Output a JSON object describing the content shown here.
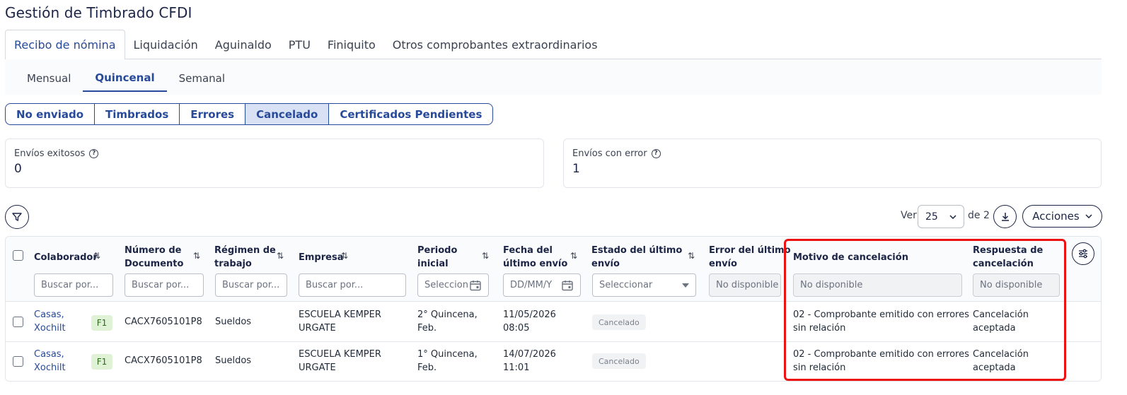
{
  "page": {
    "title": "Gestión de Timbrado CFDI"
  },
  "main_tabs": [
    {
      "label": "Recibo de nómina",
      "active": true
    },
    {
      "label": "Liquidación"
    },
    {
      "label": "Aguinaldo"
    },
    {
      "label": "PTU"
    },
    {
      "label": "Finiquito"
    },
    {
      "label": "Otros comprobantes extraordinarios"
    }
  ],
  "sub_tabs": [
    {
      "label": "Mensual"
    },
    {
      "label": "Quincenal",
      "active": true
    },
    {
      "label": "Semanal"
    }
  ],
  "status_filters": [
    {
      "label": "No enviado"
    },
    {
      "label": "Timbrados"
    },
    {
      "label": "Errores"
    },
    {
      "label": "Cancelado",
      "active": true
    },
    {
      "label": "Certificados Pendientes"
    }
  ],
  "stats": {
    "success": {
      "label": "Envíos exitosos",
      "value": "0"
    },
    "error": {
      "label": "Envíos con error",
      "value": "1"
    }
  },
  "toolbar": {
    "ver_label": "Ver",
    "page_size": "25",
    "de_label": "de 2",
    "actions_label": "Acciones"
  },
  "table": {
    "headers": {
      "colaborador": "Colaborador",
      "numero_doc": [
        "Número de",
        "Documento"
      ],
      "regimen": [
        "Régimen de",
        "trabajo"
      ],
      "empresa": "Empresa",
      "periodo": [
        "Periodo",
        "inicial"
      ],
      "fecha": [
        "Fecha del",
        "último envío"
      ],
      "estado": [
        "Estado del último",
        "envío"
      ],
      "error": [
        "Error del último",
        "envío"
      ],
      "motivo": "Motivo de cancelación",
      "respuesta": [
        "Respuesta de",
        "cancelación"
      ]
    },
    "filters": {
      "colaborador": "Buscar por...",
      "numero_doc": "Buscar por...",
      "regimen": "Buscar por...",
      "empresa": "Buscar por...",
      "periodo": "Seleccion",
      "fecha": "DD/MM/Y",
      "estado": "Seleccionar",
      "error": "No disponible",
      "motivo": "No disponible",
      "respuesta": "No disponible"
    },
    "rows": [
      {
        "colaborador": [
          "Casas,",
          "Xochilt"
        ],
        "badge": "F1",
        "numero_doc": "CACX7605101P8",
        "regimen": "Sueldos",
        "empresa": [
          "ESCUELA KEMPER",
          "URGATE"
        ],
        "periodo": [
          "2° Quincena,",
          "Feb."
        ],
        "fecha": [
          "11/05/2026",
          "08:05"
        ],
        "estado": "Cancelado",
        "motivo": [
          "02 - Comprobante emitido con errores",
          "sin relación"
        ],
        "respuesta": [
          "Cancelación",
          "aceptada"
        ]
      },
      {
        "colaborador": [
          "Casas,",
          "Xochilt"
        ],
        "badge": "F1",
        "numero_doc": "CACX7605101P8",
        "regimen": "Sueldos",
        "empresa": [
          "ESCUELA KEMPER",
          "URGATE"
        ],
        "periodo": [
          "1° Quincena,",
          "Feb."
        ],
        "fecha": [
          "14/07/2026",
          "11:01"
        ],
        "estado": "Cancelado",
        "motivo": [
          "02 - Comprobante emitido con errores",
          "sin relación"
        ],
        "respuesta": [
          "Cancelación",
          "aceptada"
        ]
      }
    ]
  },
  "colors": {
    "primary": "#274a9a",
    "highlight": "#ee1111",
    "badge_bg": "#dff2d6"
  }
}
